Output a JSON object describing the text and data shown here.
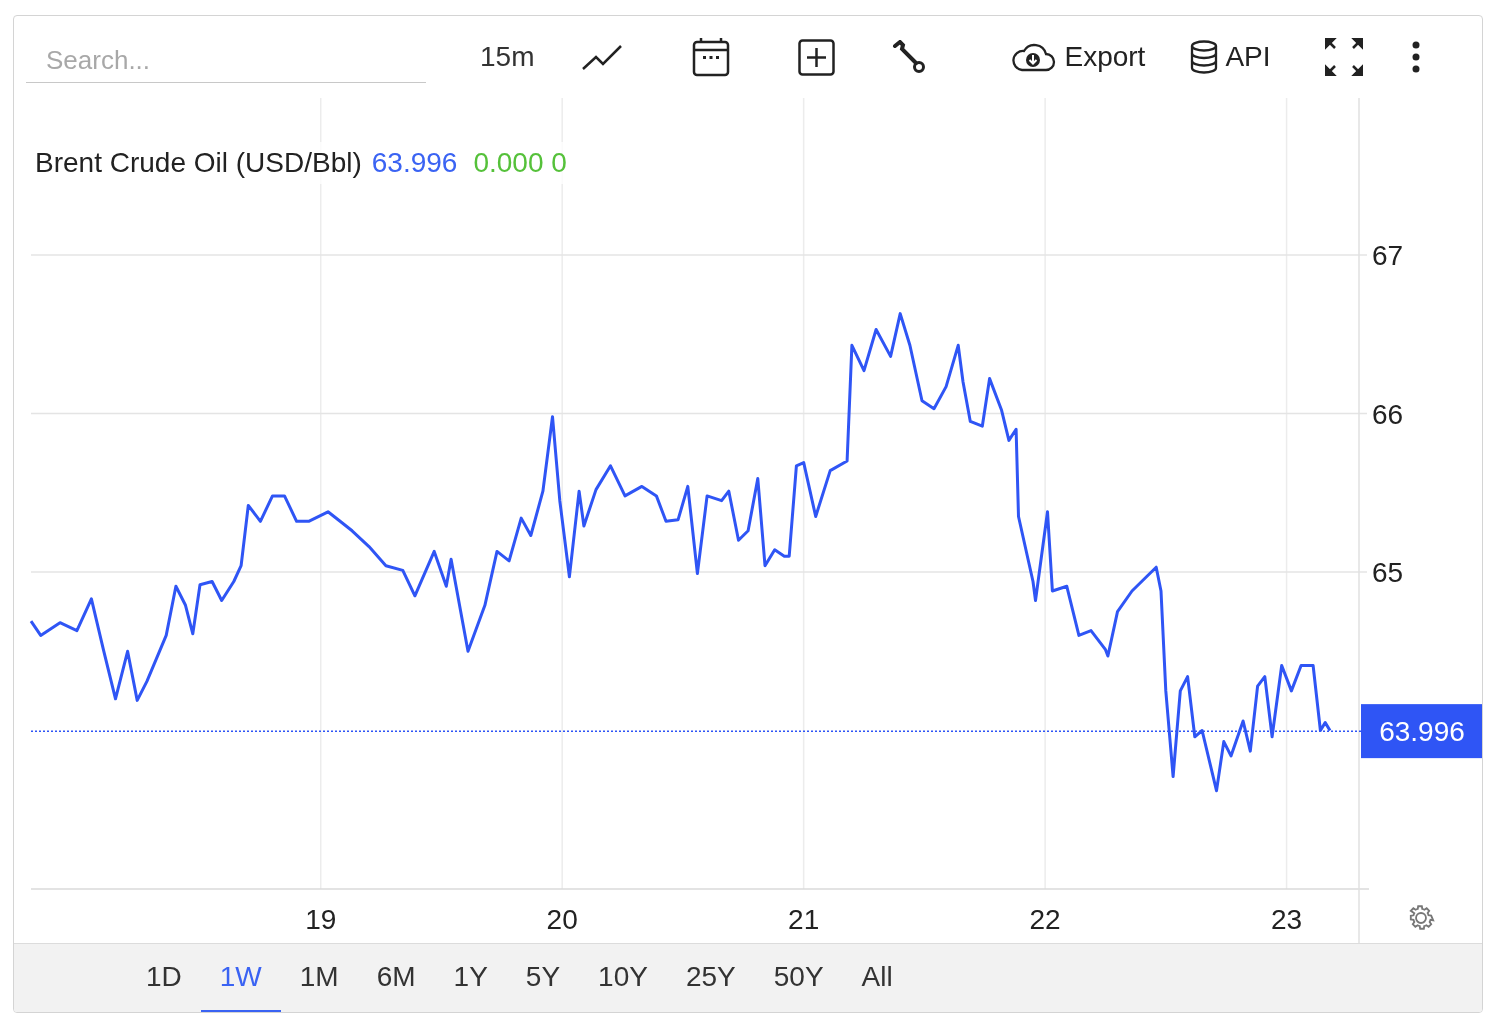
{
  "toolbar": {
    "search": {
      "placeholder": "Search..."
    },
    "interval": "15m",
    "export": "Export",
    "api": "API"
  },
  "legend": {
    "name": "Brent Crude Oil (USD/Bbl)",
    "price": "63.996",
    "change": "0.000 0"
  },
  "chart": {
    "chart_data": {
      "type": "line",
      "grid": true,
      "ref_lines": [
        {
          "axis": "y",
          "value": 63.996,
          "label": "63.996"
        }
      ],
      "xlim": [
        17.8,
        23.3
      ],
      "ylim": [
        63,
        68
      ],
      "xticks": [
        19,
        20,
        21,
        22,
        23
      ],
      "yticks": [
        65,
        66,
        67
      ],
      "x": [
        17.8,
        17.84,
        17.92,
        17.99,
        18.05,
        18.1,
        18.15,
        18.2,
        18.24,
        18.28,
        18.36,
        18.4,
        18.44,
        18.47,
        18.5,
        18.55,
        18.59,
        18.64,
        18.67,
        18.7,
        18.75,
        18.8,
        18.85,
        18.9,
        18.95,
        19.03,
        19.08,
        19.13,
        19.2,
        19.27,
        19.34,
        19.39,
        19.47,
        19.52,
        19.54,
        19.61,
        19.68,
        19.73,
        19.78,
        19.83,
        19.87,
        19.92,
        19.96,
        19.99,
        20.03,
        20.07,
        20.09,
        20.14,
        20.2,
        20.26,
        20.33,
        20.39,
        20.43,
        20.48,
        20.52,
        20.56,
        20.6,
        20.66,
        20.69,
        20.73,
        20.77,
        20.81,
        20.84,
        20.88,
        20.92,
        20.94,
        20.97,
        21.0,
        21.05,
        21.11,
        21.18,
        21.2,
        21.25,
        21.3,
        21.36,
        21.4,
        21.44,
        21.49,
        21.54,
        21.59,
        21.64,
        21.66,
        21.69,
        21.74,
        21.77,
        21.82,
        21.85,
        21.88,
        21.89,
        21.95,
        21.96,
        22.01,
        22.03,
        22.09,
        22.14,
        22.19,
        22.25,
        22.26,
        22.3,
        22.36,
        22.42,
        22.46,
        22.48,
        22.5,
        22.53,
        22.56,
        22.59,
        22.62,
        22.65,
        22.71,
        22.74,
        22.77,
        22.82,
        22.85,
        22.88,
        22.91,
        22.94,
        22.98,
        23.02,
        23.06,
        23.11,
        23.14,
        23.16,
        23.18
      ],
      "series": [
        {
          "color": "#2f55f5",
          "values": [
            64.69,
            64.6,
            64.68,
            64.63,
            64.83,
            64.51,
            64.2,
            64.5,
            64.19,
            64.31,
            64.6,
            64.91,
            64.79,
            64.61,
            64.92,
            64.94,
            64.82,
            64.94,
            65.04,
            65.42,
            65.32,
            65.48,
            65.48,
            65.32,
            65.32,
            65.38,
            65.32,
            65.26,
            65.16,
            65.04,
            65.01,
            64.85,
            65.13,
            64.91,
            65.08,
            64.5,
            64.79,
            65.13,
            65.07,
            65.34,
            65.23,
            65.51,
            65.98,
            65.45,
            64.97,
            65.51,
            65.29,
            65.52,
            65.67,
            65.48,
            65.54,
            65.48,
            65.32,
            65.33,
            65.54,
            64.99,
            65.48,
            65.45,
            65.51,
            65.2,
            65.26,
            65.59,
            65.04,
            65.14,
            65.1,
            65.1,
            65.67,
            65.69,
            65.35,
            65.64,
            65.7,
            66.43,
            66.27,
            66.53,
            66.36,
            66.63,
            66.43,
            66.08,
            66.03,
            66.17,
            66.43,
            66.2,
            65.95,
            65.92,
            66.22,
            66.02,
            65.83,
            65.9,
            65.35,
            64.94,
            64.82,
            65.38,
            64.88,
            64.91,
            64.6,
            64.63,
            64.51,
            64.47,
            64.75,
            64.88,
            64.97,
            65.03,
            64.88,
            64.25,
            63.71,
            64.25,
            64.34,
            63.96,
            64.0,
            63.62,
            63.93,
            63.84,
            64.06,
            63.87,
            64.28,
            64.34,
            63.96,
            64.41,
            64.25,
            64.41,
            64.41,
            64.0,
            64.05,
            64.0
          ]
        }
      ]
    }
  },
  "ranges": [
    {
      "label": "1D",
      "selected": false
    },
    {
      "label": "1W",
      "selected": true
    },
    {
      "label": "1M",
      "selected": false
    },
    {
      "label": "6M",
      "selected": false
    },
    {
      "label": "1Y",
      "selected": false
    },
    {
      "label": "5Y",
      "selected": false
    },
    {
      "label": "10Y",
      "selected": false
    },
    {
      "label": "25Y",
      "selected": false
    },
    {
      "label": "50Y",
      "selected": false
    },
    {
      "label": "All",
      "selected": false
    }
  ]
}
